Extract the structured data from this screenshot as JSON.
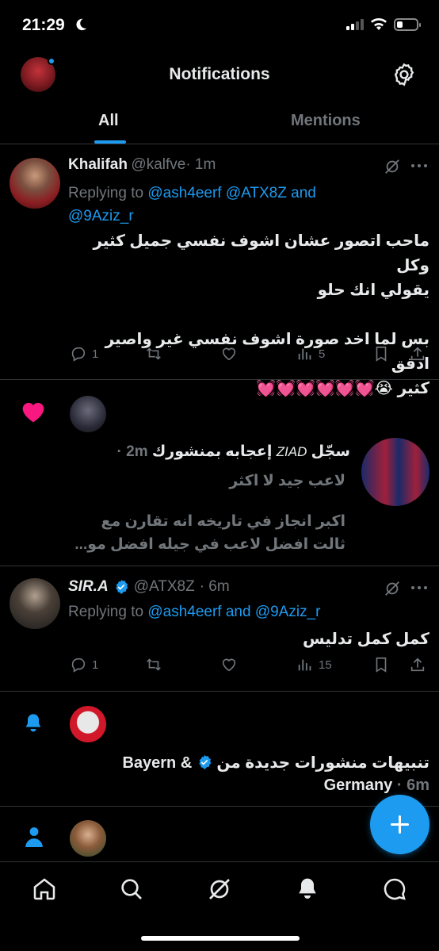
{
  "status_bar": {
    "time": "21:29"
  },
  "header": {
    "title": "Notifications"
  },
  "tabs": [
    {
      "label": "All"
    },
    {
      "label": "Mentions"
    }
  ],
  "notifications": [
    {
      "type": "reply",
      "name": "Khalifah",
      "handle": "@kalfve",
      "time": "· 1m",
      "replying_to_prefix": "Replying to ",
      "replying_to_l1": "@ash4eerf @ATX8Z and",
      "replying_to_l2": "@9Aziz_r",
      "text_l1": "ماحب اتصور عشان اشوف نفسي جميل كثير وكل",
      "text_l2": "يقولي انك حلو",
      "text_l3": "بس لما اخد صورة اشوف نفسي غير واصير ادقق",
      "text_l4": "كثير 😭💓💓💓💓💓💓",
      "replies": "1",
      "views": "5"
    },
    {
      "type": "like",
      "title_name": "ZIAD",
      "title_prefix": "سجّل ",
      "title_suffix": " إعجابه بمنشورك",
      "time": "2m ·",
      "quote_l1": "لاعب جيد لا اكثر",
      "quote_l2": "اكبر انجاز في تاريخه انه تقارن مع",
      "quote_l3": "ثالت افضل لاعب في جيله افضل مو..."
    },
    {
      "type": "reply",
      "name": "SIR.A",
      "handle": "@ATX8Z",
      "time": "· 6m",
      "replying_to_prefix": "Replying to ",
      "replying_to_l1": "@ash4eerf and @9Aziz_r",
      "text_l1": "كمل كمل تدليس",
      "replies": "1",
      "views": "15"
    },
    {
      "type": "new_posts",
      "text_ar": "تنبيهات منشورات جديدة من",
      "account_l1": "Bayern &",
      "account_l2": "Germany",
      "time": "· 6m"
    }
  ],
  "colors": {
    "accent": "#1d9bf0",
    "like": "#f91880",
    "background": "#000000"
  },
  "icons": [
    "home-icon",
    "search-icon",
    "grok-icon",
    "bell-icon",
    "messages-icon"
  ]
}
